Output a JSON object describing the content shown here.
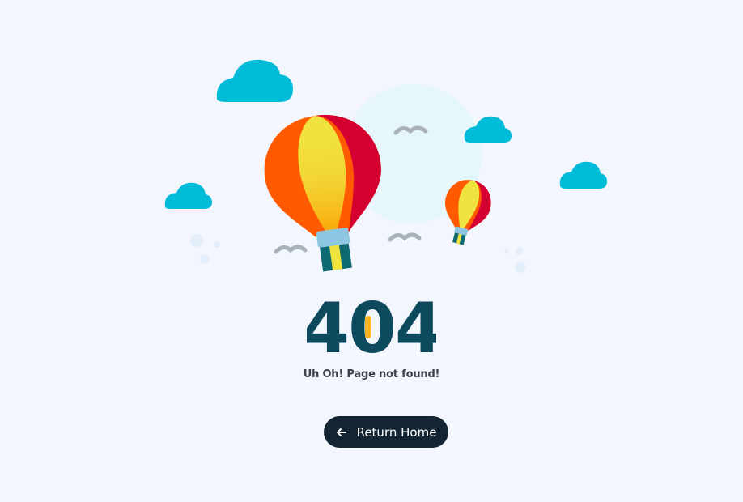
{
  "error": {
    "code": "404",
    "message": "Uh Oh! Page not found!"
  },
  "actions": {
    "return_label": "Return Home",
    "return_icon": "arrow-left-icon"
  },
  "colors": {
    "background": "#f4f6fd",
    "code_text": "#0e4a5e",
    "button_bg": "#132533",
    "cloud": "#00bcd8",
    "accent_yellow": "#f5b51b"
  }
}
